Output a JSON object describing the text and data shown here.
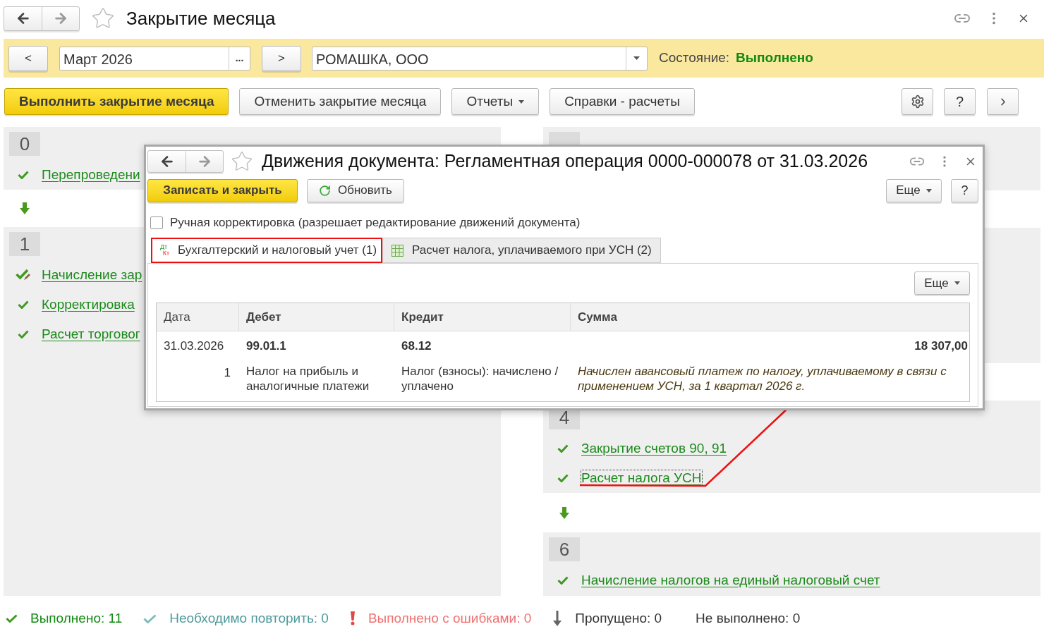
{
  "window": {
    "title": "Закрытие месяца"
  },
  "filter_bar": {
    "prev_button": "<",
    "period": "Март 2026",
    "period_choose_button": "...",
    "next_button": ">",
    "organization": "РОМАШКА, ООО",
    "state_label": "Состояние:",
    "state_value": "Выполнено"
  },
  "toolbar": {
    "buttons": [
      {
        "label": "Выполнить закрытие месяца",
        "kind": "primary"
      },
      {
        "label": "Отменить закрытие месяца",
        "kind": "plain"
      },
      {
        "label": "Отчеты",
        "kind": "dropdown"
      },
      {
        "label": "Справки - расчеты",
        "kind": "plain"
      }
    ],
    "help_button": "?"
  },
  "columns": [
    {
      "blocks": [
        {
          "kind": "stage",
          "number": "0",
          "items": [
            {
              "title": "Перепроведени",
              "kind": "done",
              "focused": false,
              "annotated": false
            }
          ]
        },
        {
          "kind": "arrow"
        },
        {
          "kind": "stage",
          "number": "1",
          "items": [
            {
              "title": "Начисление зар",
              "kind": "done_edited",
              "focused": false,
              "annotated": false
            },
            {
              "title": "Корректировка",
              "kind": "done",
              "focused": false,
              "annotated": false
            },
            {
              "title": "Расчет торговог",
              "kind": "done",
              "focused": false,
              "annotated": false
            }
          ]
        }
      ]
    },
    {
      "blocks": [
        {
          "kind": "stage"
        },
        {
          "kind": "gap"
        },
        {
          "kind": "stage"
        },
        {
          "kind": "gap"
        },
        {
          "kind": "stage",
          "number": "4",
          "items": [
            {
              "title": "Закрытие счетов 90, 91",
              "kind": "done",
              "focused": false,
              "annotated": false
            },
            {
              "title": "Расчет налога УСН",
              "kind": "done",
              "focused": true,
              "annotated": true
            }
          ]
        },
        {
          "kind": "arrow"
        },
        {
          "kind": "stage",
          "number": "6",
          "items": [
            {
              "title": "Начисление налогов на единый налоговый счет",
              "kind": "done",
              "focused": false,
              "annotated": false
            }
          ]
        }
      ]
    }
  ],
  "status_bar": [
    {
      "kind": "done",
      "label": "Выполнено:",
      "count": "11"
    },
    {
      "kind": "repeat",
      "label": "Необходимо повторить:",
      "count": "0"
    },
    {
      "kind": "error",
      "label": "Выполнено с ошибками:",
      "count": "0"
    },
    {
      "kind": "skipped",
      "label": "Пропущено:",
      "count": "0"
    },
    {
      "kind": "not_done",
      "label": "Не выполнено:",
      "count": "0"
    }
  ],
  "dialog": {
    "title": "Движения документа: Регламентная операция 0000-000078 от 31.03.2026",
    "buttons": [
      {
        "label": "Записать и закрыть",
        "kind": "primary"
      },
      {
        "label": "Обновить",
        "kind": "refresh"
      }
    ],
    "more_button": "Еще",
    "help_button": "?",
    "manual_correction": {
      "label": "Ручная корректировка (разрешает редактирование движений документа)",
      "checked": false
    },
    "tabs": [
      {
        "label": "Бухгалтерский и налоговый учет (1)",
        "kind": "accounting",
        "icon_top": "Дт",
        "icon_bottom": "Кт",
        "selected": true,
        "highlighted": true
      },
      {
        "label": "Расчет налога, уплачиваемого при УСН (2)",
        "kind": "table",
        "selected": false,
        "highlighted": false
      }
    ],
    "table_more_button": "Еще",
    "table": {
      "columns": [
        "Дата",
        "Дебет",
        "Кредит",
        "Сумма"
      ],
      "rows": [
        {
          "date": "31.03.2026",
          "line": "1",
          "debit": "99.01.1",
          "debit_name": "Налог на прибыль и аналогичные платежи",
          "credit": "68.12",
          "credit_name": "Налог (взносы): начислено / уплачено",
          "amount": "18 307,00",
          "content": "Начислен авансовый платеж по налогу, уплачиваемому в связи с применением УСН, за 1 квартал 2026 г."
        }
      ]
    }
  }
}
